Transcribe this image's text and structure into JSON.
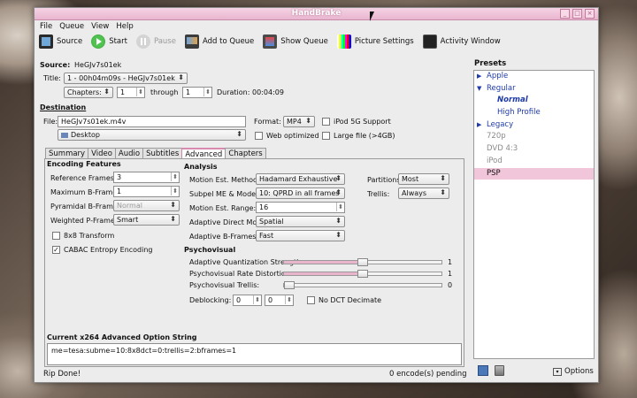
{
  "window": {
    "title": "HandBrake"
  },
  "menu": [
    "File",
    "Queue",
    "View",
    "Help"
  ],
  "toolbar": {
    "source": "Source",
    "start": "Start",
    "pause": "Pause",
    "add_queue": "Add to Queue",
    "show_queue": "Show Queue",
    "picture_settings": "Picture Settings",
    "activity_window": "Activity Window"
  },
  "source": {
    "label": "Source:",
    "value": "HeGJv7s01ek",
    "title_label": "Title:",
    "title_value": "1 - 00h04m09s - HeGJv7s01ek",
    "chapters_combo": "Chapters:",
    "chapter_from": "1",
    "through_label": "through",
    "chapter_to": "1",
    "duration_label": "Duration:",
    "duration_value": "00:04:09"
  },
  "destination": {
    "label": "Destination",
    "file_label": "File:",
    "file_value": "HeGJv7s01ek.m4v",
    "folder": "Desktop",
    "format_label": "Format:",
    "format_value": "MP4",
    "ipod_label": "iPod 5G Support",
    "web_label": "Web optimized",
    "large_label": "Large file (>4GB)"
  },
  "tabs": [
    "Summary",
    "Video",
    "Audio",
    "Subtitles",
    "Advanced",
    "Chapters"
  ],
  "encoding": {
    "heading": "Encoding Features",
    "ref_frames_label": "Reference Frames:",
    "ref_frames": "3",
    "max_b_label": "Maximum B-Frames:",
    "max_b": "1",
    "pyramidal_label": "Pyramidal B-Frames:",
    "pyramidal": "Normal",
    "weighted_label": "Weighted P-Frames:",
    "weighted": "Smart",
    "transform_label": "8x8 Transform",
    "cabac_label": "CABAC Entropy Encoding"
  },
  "analysis": {
    "heading": "Analysis",
    "motion_method_label": "Motion Est. Method:",
    "motion_method": "Hadamard Exhaustive",
    "subpel_label": "Subpel ME & Mode:",
    "subpel": "10: QPRD in all frames",
    "motion_range_label": "Motion Est. Range:",
    "motion_range": "16",
    "adaptive_direct_label": "Adaptive Direct Mode:",
    "adaptive_direct": "Spatial",
    "adaptive_b_label": "Adaptive B-Frames:",
    "adaptive_b": "Fast",
    "partitions_label": "Partitions:",
    "partitions": "Most",
    "trellis_label": "Trellis:",
    "trellis": "Always"
  },
  "psychovisual": {
    "heading": "Psychovisual",
    "aq_label": "Adaptive Quantization Strength:",
    "aq_value": "1",
    "aq_level": 0.5,
    "rd_label": "Psychovisual Rate Distortion:",
    "rd_value": "1",
    "rd_level": 0.5,
    "trellis_label": "Psychovisual Trellis:",
    "trellis_value": "0",
    "trellis_level": 0,
    "deblocking_label": "Deblocking:",
    "deblock_a": "0",
    "deblock_b": "0",
    "no_dct_label": "No DCT Decimate"
  },
  "option_string": {
    "label": "Current x264 Advanced Option String",
    "value": "me=tesa:subme=10:8x8dct=0:trellis=2:bframes=1"
  },
  "presets": {
    "title": "Presets",
    "items": [
      "Apple",
      "Regular",
      "Normal",
      "High Profile",
      "Legacy",
      "720p",
      "DVD 4:3",
      "iPod",
      "PSP"
    ],
    "options_label": "Options"
  },
  "status": {
    "left": "Rip Done!",
    "right": "0 encode(s) pending"
  }
}
